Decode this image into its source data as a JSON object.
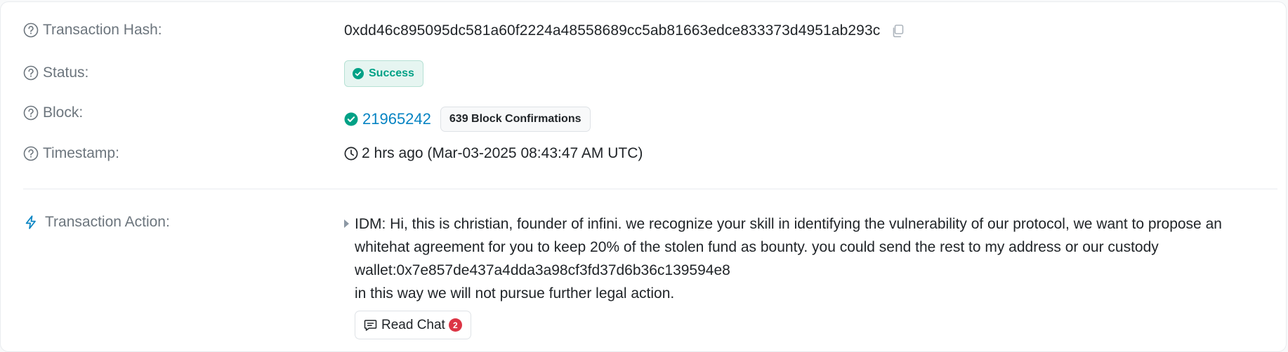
{
  "details": {
    "tx_hash": {
      "label": "Transaction Hash:",
      "value": "0xdd46c895095dc581a60f2224a48558689cc5ab81663edce833373d4951ab293c",
      "icon": "copy-icon"
    },
    "status": {
      "label": "Status:",
      "value": "Success",
      "icon": "check-circle-icon"
    },
    "block": {
      "label": "Block:",
      "number": "21965242",
      "confirmations": "639 Block Confirmations"
    },
    "timestamp": {
      "label": "Timestamp:",
      "value": "2 hrs ago (Mar-03-2025 08:43:47 AM UTC)",
      "icon": "clock-icon"
    }
  },
  "action": {
    "label": "Transaction Action:",
    "icon": "lightning-icon",
    "message_lines": [
      "IDM: Hi, this is christian, founder of infini. we recognize your skill in identifying the vulnerability of our protocol, we want to propose an",
      "whitehat agreement for you to keep 20% of the stolen fund as bounty. you could send the rest to my address or our custody",
      "wallet:0x7e857de437a4dda3a98cf3fd37d6b36c139594e8",
      "in this way we will not pursue further legal action."
    ],
    "read_chat_label": "Read Chat",
    "chat_count": "2"
  },
  "colors": {
    "label": "#6c757d",
    "text": "#212529",
    "link": "#0784c3",
    "success": "#00a186",
    "success_bg": "#e6f5f1",
    "danger": "#dc3545"
  }
}
